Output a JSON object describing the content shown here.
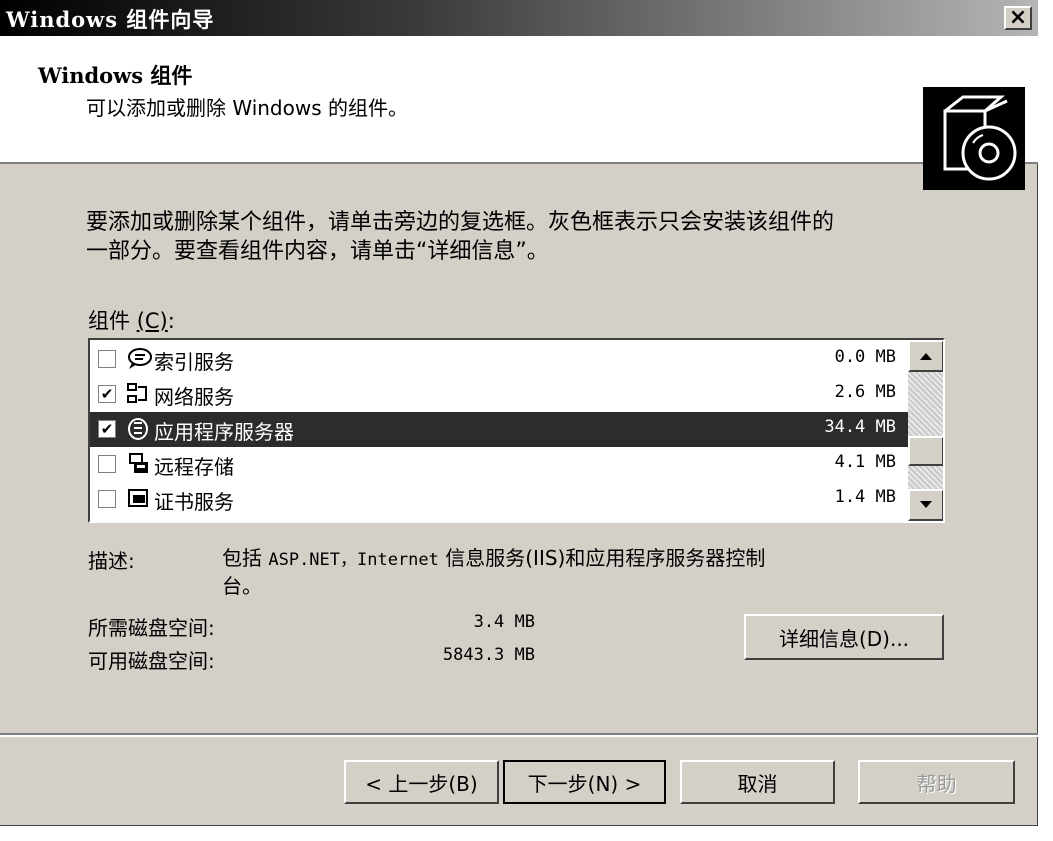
{
  "window": {
    "title": "Windows 组件向导",
    "close_glyph": "×"
  },
  "header": {
    "title": "Windows 组件",
    "subtitle": "可以添加或删除 Windows 的组件。"
  },
  "instructions": {
    "line1": "要添加或删除某个组件，请单击旁边的复选框。灰色框表示只会安装该组件的",
    "line2": "一部分。要查看组件内容，请单击“详细信息”。"
  },
  "components_label": {
    "text": "组件",
    "accel": "(C)",
    "suffix": ":"
  },
  "components": [
    {
      "name": "索引服务",
      "size": "0.0 MB",
      "checked": false,
      "selected": false,
      "icon": "index-service-icon"
    },
    {
      "name": "网络服务",
      "size": "2.6 MB",
      "checked": true,
      "selected": false,
      "icon": "network-service-icon"
    },
    {
      "name": "应用程序服务器",
      "size": "34.4 MB",
      "checked": true,
      "selected": true,
      "icon": "app-server-icon"
    },
    {
      "name": "远程存储",
      "size": "4.1 MB",
      "checked": false,
      "selected": false,
      "icon": "remote-storage-icon"
    },
    {
      "name": "证书服务",
      "size": "1.4 MB",
      "checked": false,
      "selected": false,
      "icon": "certificate-service-icon"
    }
  ],
  "description": {
    "label": "描述:",
    "text_a": "包括 ",
    "text_mono": "ASP.NET，Internet",
    "text_b": " 信息服务(IIS)和应用程序服务器控制",
    "text_line2": "台。"
  },
  "disk": {
    "required_label": "所需磁盘空间:",
    "required_value": "3.4 MB",
    "available_label": "可用磁盘空间:",
    "available_value": "5843.3 MB"
  },
  "buttons": {
    "details": "详细信息(D)...",
    "back": "< 上一步(B)",
    "next": "下一步(N) >",
    "cancel": "取消",
    "help": "帮助"
  },
  "colors": {
    "face": "#d4d0c8",
    "selection": "#2c2c2c",
    "titlebar_start": "#000000",
    "titlebar_end": "#b5b5b5"
  }
}
